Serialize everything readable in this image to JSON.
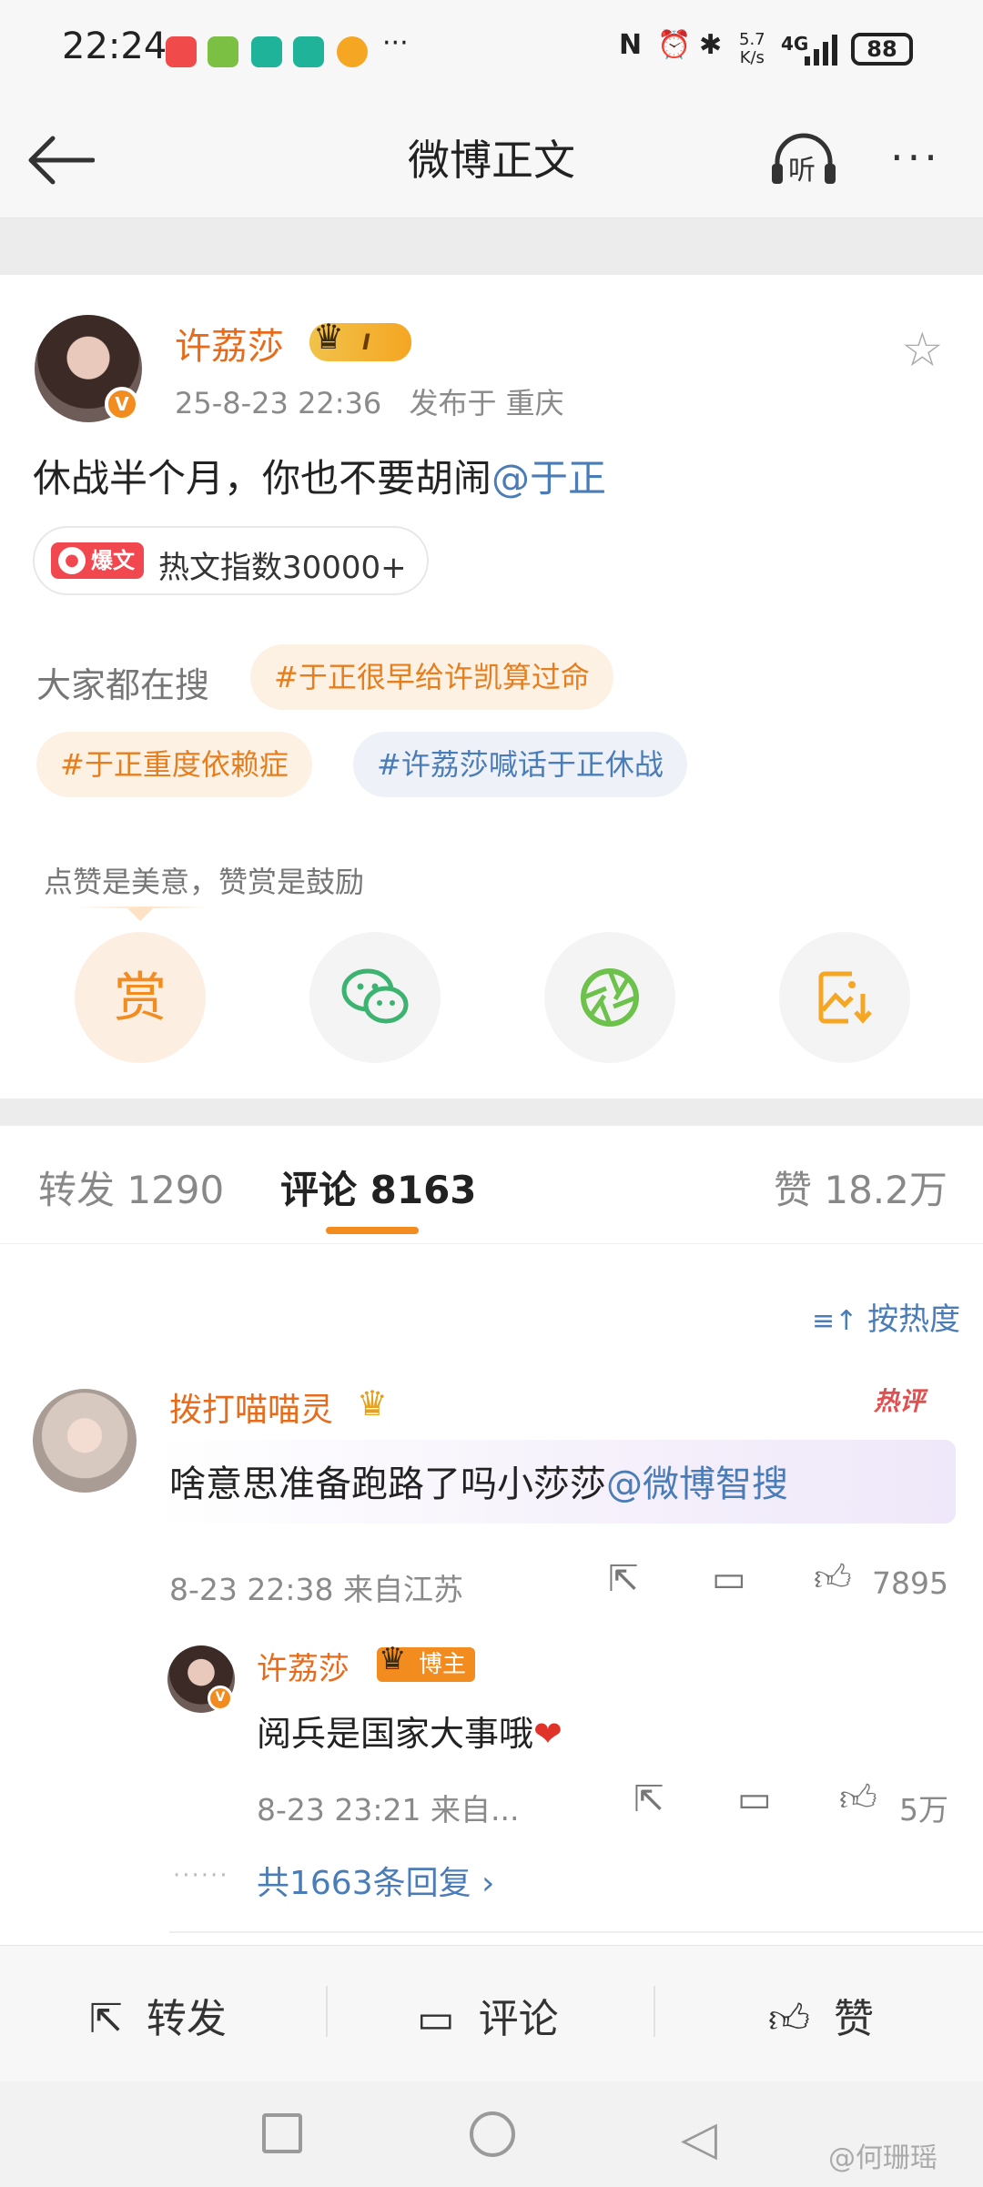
{
  "status_bar": {
    "time": "22:24",
    "more": "···",
    "net_speed_top": "5.7",
    "net_speed_bottom": "K/s",
    "network": "4G",
    "battery": "88"
  },
  "header": {
    "title": "微博正文",
    "listen_label": "听",
    "more_label": "···"
  },
  "post": {
    "author": "许荔莎",
    "level_badge": "I",
    "time": "25-8-23 22:36",
    "location": "发布于 重庆",
    "content_text": "休战半个月，你也不要胡闹",
    "content_mention": "@于正",
    "hot_tag": "爆文",
    "hot_text": "热文指数30000+",
    "search_label": "大家都在搜",
    "search_chips": [
      "#于正很早给许凯算过命",
      "#于正重度依赖症",
      "#许荔莎喊话于正休战"
    ],
    "tip": "点赞是美意，赞赏是鼓励",
    "reward_label": "赏"
  },
  "tabs": {
    "repost": "转发 1290",
    "comment": "评论 8163",
    "like": "赞 18.2万"
  },
  "sort_label": "按热度",
  "comment": {
    "name": "拨打喵喵灵",
    "hot_badge": "热评",
    "text": "啥意思准备跑路了吗小莎莎",
    "mention": "@微博智搜",
    "time_location": "8-23 22:38  来自江苏",
    "likes": "7895"
  },
  "reply": {
    "name": "许荔莎",
    "badge": "博主",
    "text": "阅兵是国家大事哦",
    "heart": "❤",
    "time_location": "8-23 23:21  来自...",
    "likes": "5万",
    "dots": "······",
    "more_replies": "共1663条回复 ›"
  },
  "action_bar": {
    "repost": "转发",
    "comment": "评论",
    "like": "赞"
  },
  "watermark": "@何珊瑶",
  "colors": {
    "accent_orange": "#f38c1f",
    "link_blue": "#4a7cb8",
    "name_orange": "#e86b1b"
  }
}
